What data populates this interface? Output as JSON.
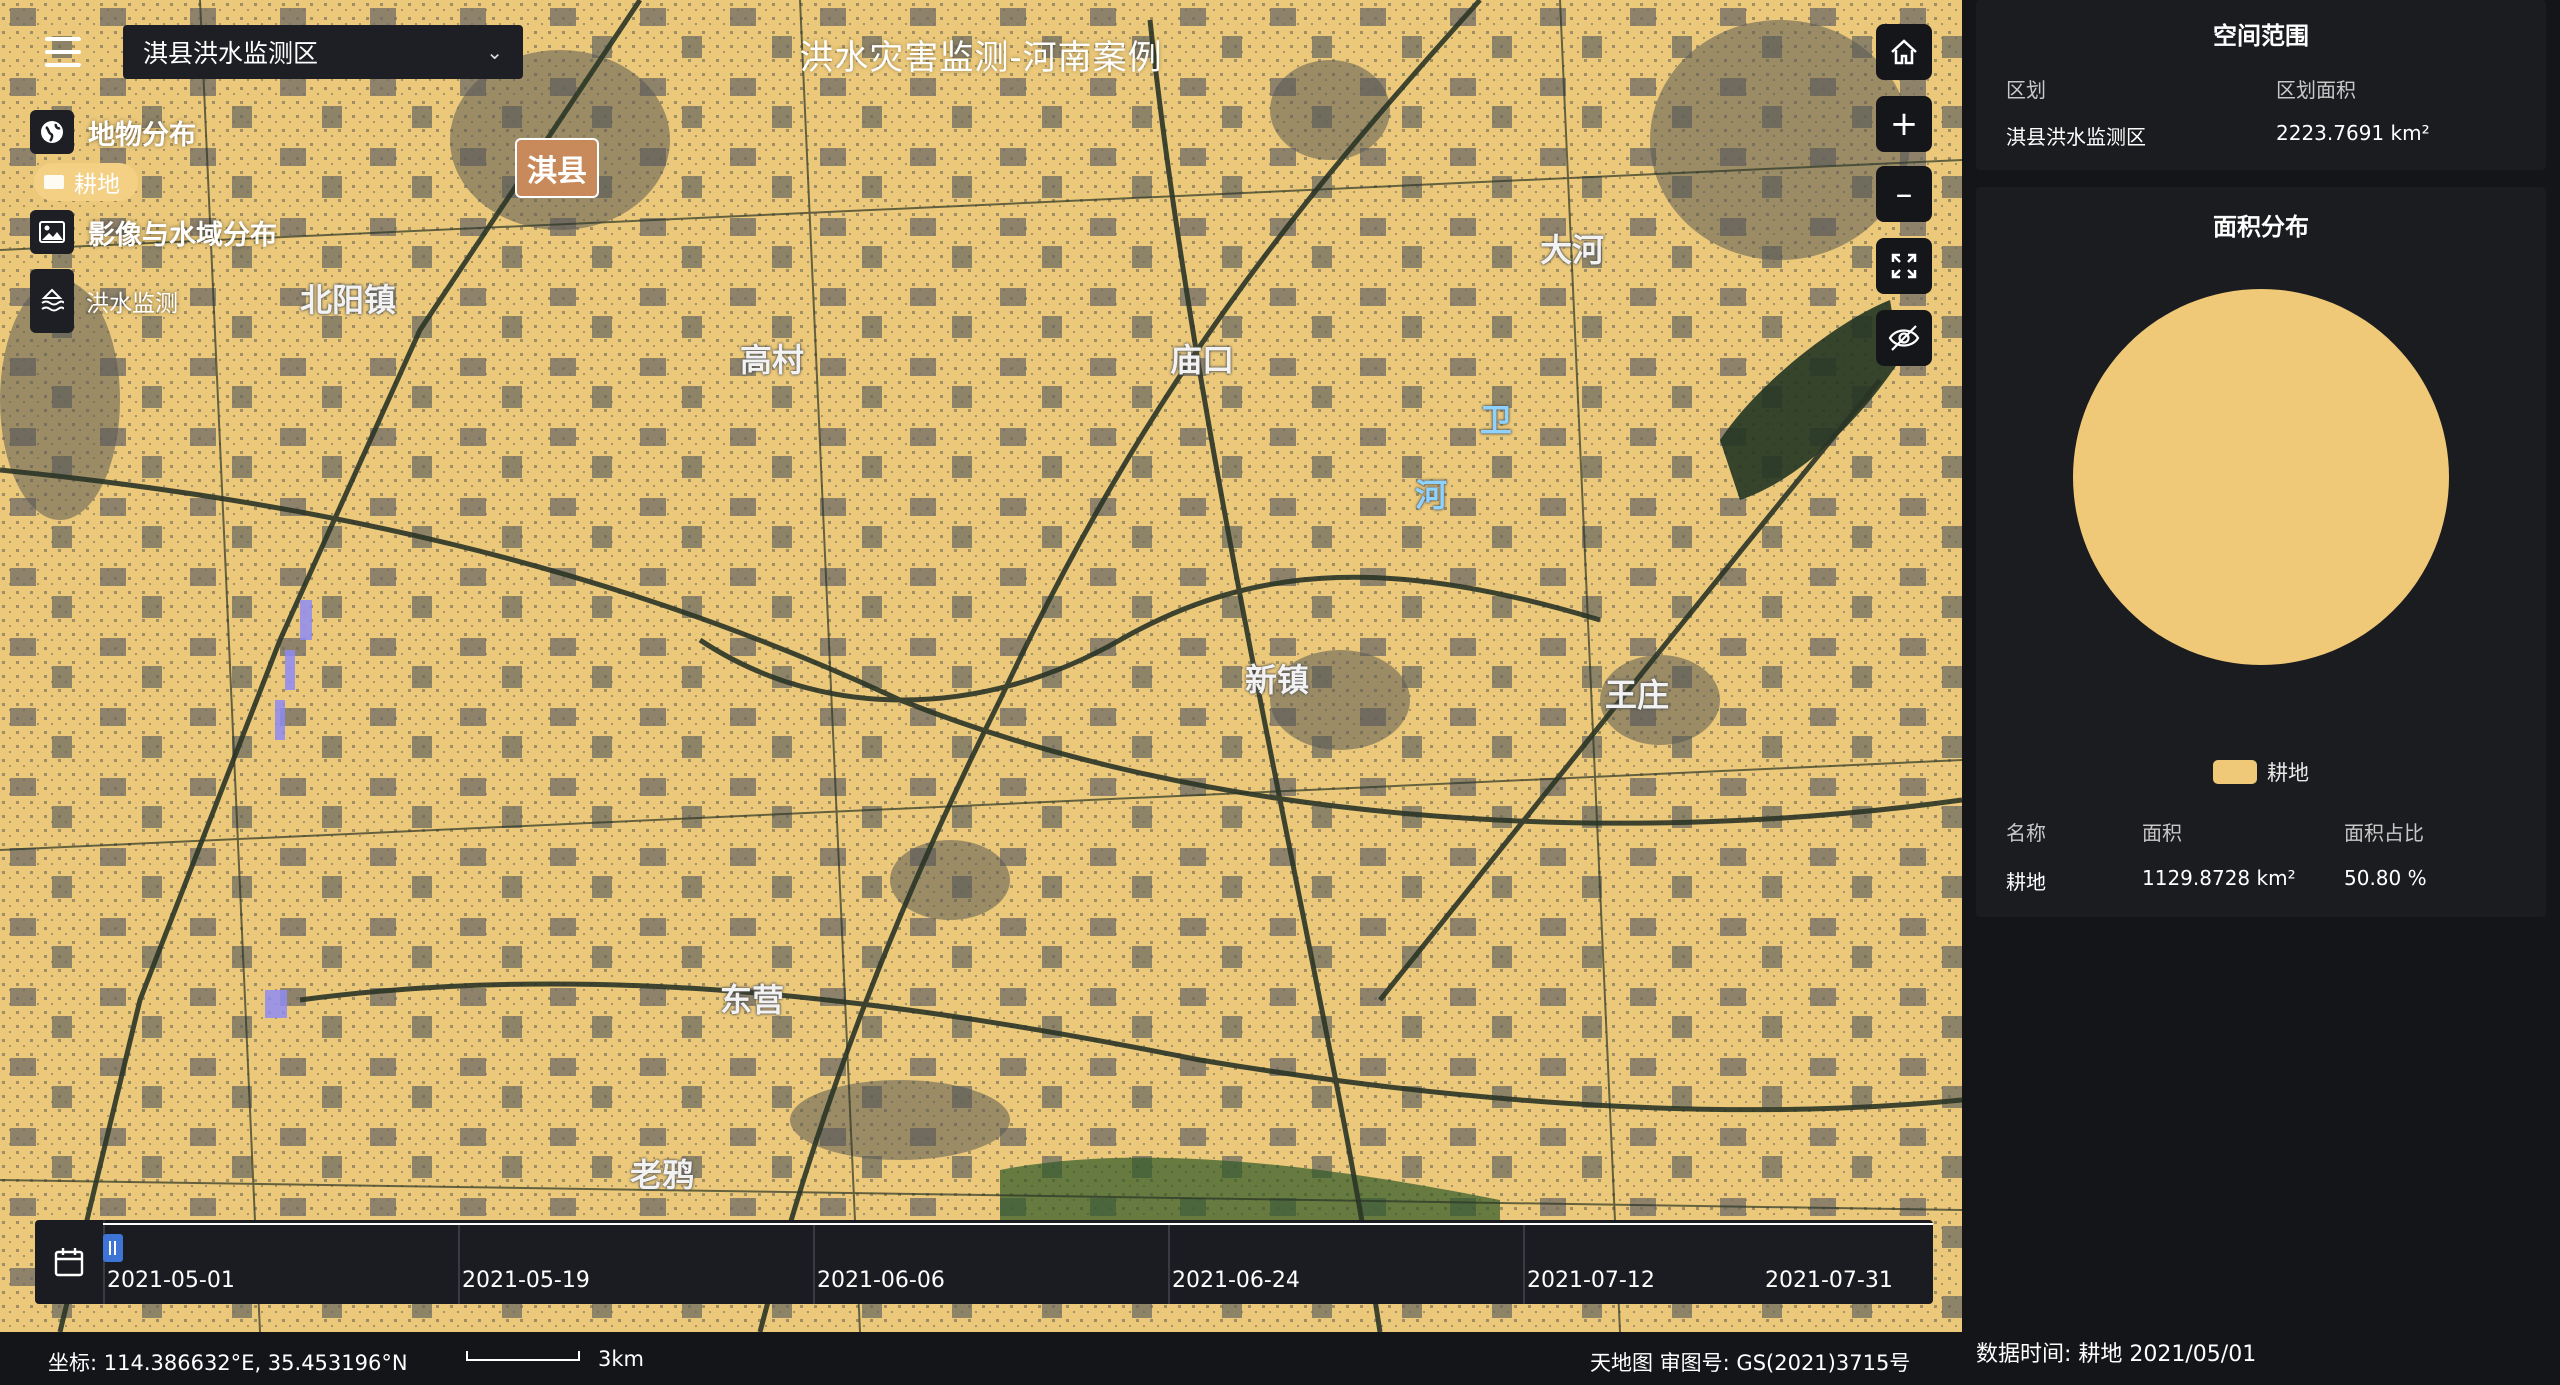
{
  "app": {
    "title": "洪水灾害监测-河南案例"
  },
  "region_select": {
    "value": "淇县洪水监测区"
  },
  "layers": {
    "land_cover_title": "地物分布",
    "land_cover_chip": "耕地",
    "imagery_title": "影像与水域分布",
    "flood_label": "洪水监测"
  },
  "map": {
    "city_badge": "淇县",
    "place_labels": [
      "高村",
      "北阳镇",
      "卫",
      "河",
      "新镇",
      "王庄",
      "大河",
      "东营",
      "庙口",
      "老鸦"
    ]
  },
  "toolbar": {
    "home_icon": "home-icon",
    "zoom_in_icon": "plus-icon",
    "zoom_out_icon": "minus-icon",
    "fullscreen_icon": "fullscreen-icon",
    "hide_icon": "eye-slash-icon"
  },
  "timeline": {
    "ticks": [
      "2021-05-01",
      "2021-05-19",
      "2021-06-06",
      "2021-06-24",
      "2021-07-12",
      "2021-07-31"
    ],
    "current_date": "2021-05-01"
  },
  "statusbar": {
    "coordinate": "坐标:  114.386632°E,  35.453196°N",
    "scale": "3km",
    "attribution": "天地图 审图号: GS(2021)3715号"
  },
  "side": {
    "spatial_title": "空间范围",
    "spatial_headers": [
      "区划",
      "区划面积"
    ],
    "spatial_row": [
      "淇县洪水监测区",
      "2223.7691 km²"
    ],
    "area_title": "面积分布",
    "legend": "耕地",
    "table_headers": [
      "名称",
      "面积",
      "面积占比"
    ],
    "table_row": [
      "耕地",
      "1129.8728 km²",
      "50.80 %"
    ],
    "data_time": "数据时间: 耕地 2021/05/01"
  },
  "colors": {
    "cropland": "#f0c978",
    "panel_bg": "#1b1c20",
    "timeline_handle": "#3d74d6"
  },
  "chart_data": {
    "type": "pie",
    "categories": [
      "耕地"
    ],
    "values": [
      100
    ]
  }
}
